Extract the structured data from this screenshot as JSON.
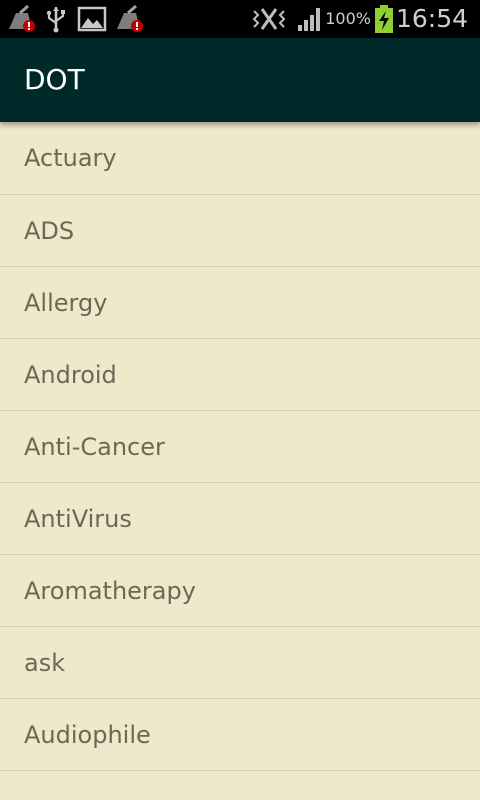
{
  "status_bar": {
    "battery_percent": "100%",
    "time": "16:54",
    "icons": [
      "cleaner-alert-icon",
      "usb-icon",
      "image-icon",
      "cleaner-alert-icon",
      "vibrate-icon",
      "signal-icon",
      "battery-charging-icon"
    ]
  },
  "action_bar": {
    "title": "DOT",
    "background": "#002929"
  },
  "list": {
    "items": [
      {
        "label": "Actuary"
      },
      {
        "label": "ADS"
      },
      {
        "label": "Allergy"
      },
      {
        "label": "Android"
      },
      {
        "label": "Anti-Cancer"
      },
      {
        "label": "AntiVirus"
      },
      {
        "label": "Aromatherapy"
      },
      {
        "label": "ask"
      },
      {
        "label": "Audiophile"
      }
    ]
  }
}
